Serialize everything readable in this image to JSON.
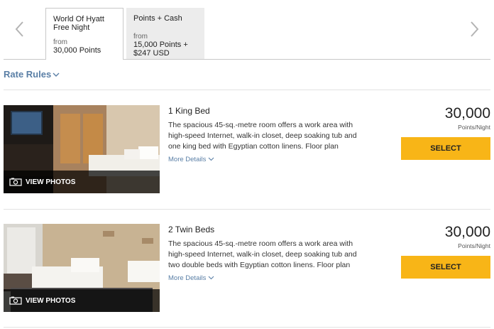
{
  "tabs": [
    {
      "title": "World Of Hyatt\nFree Night",
      "from": "from",
      "value": "30,000 Points",
      "active": true
    },
    {
      "title": "Points + Cash",
      "from": "from",
      "value": "15,000 Points +\n$247 USD",
      "active": false
    }
  ],
  "rate_rules": {
    "label": "Rate Rules"
  },
  "rooms": [
    {
      "name": "1 King Bed",
      "description": "The spacious 45-sq.-metre room offers a work area with high-speed Internet, walk-in closet, deep soaking tub and one king bed with Egyptian cotton linens. Floor plan",
      "more_details": "More Details",
      "photos_label": "VIEW PHOTOS",
      "price": "30,000",
      "price_unit": "Points/Night",
      "select_label": "SELECT"
    },
    {
      "name": "2 Twin Beds",
      "description": "The spacious 45-sq.-metre room offers a work area with high-speed Internet, walk-in closet, deep soaking tub and two double beds with Egyptian cotton linens. Floor plan",
      "more_details": "More Details",
      "photos_label": "VIEW PHOTOS",
      "price": "30,000",
      "price_unit": "Points/Night",
      "select_label": "SELECT"
    }
  ],
  "colors": {
    "accent_link": "#5a7fa6",
    "select_button": "#f8b517",
    "photo_overlay": "#000000"
  },
  "icons": {
    "prev": "chevron-left-icon",
    "next": "chevron-right-icon",
    "camera": "camera-icon",
    "expand": "chevron-down-icon"
  }
}
